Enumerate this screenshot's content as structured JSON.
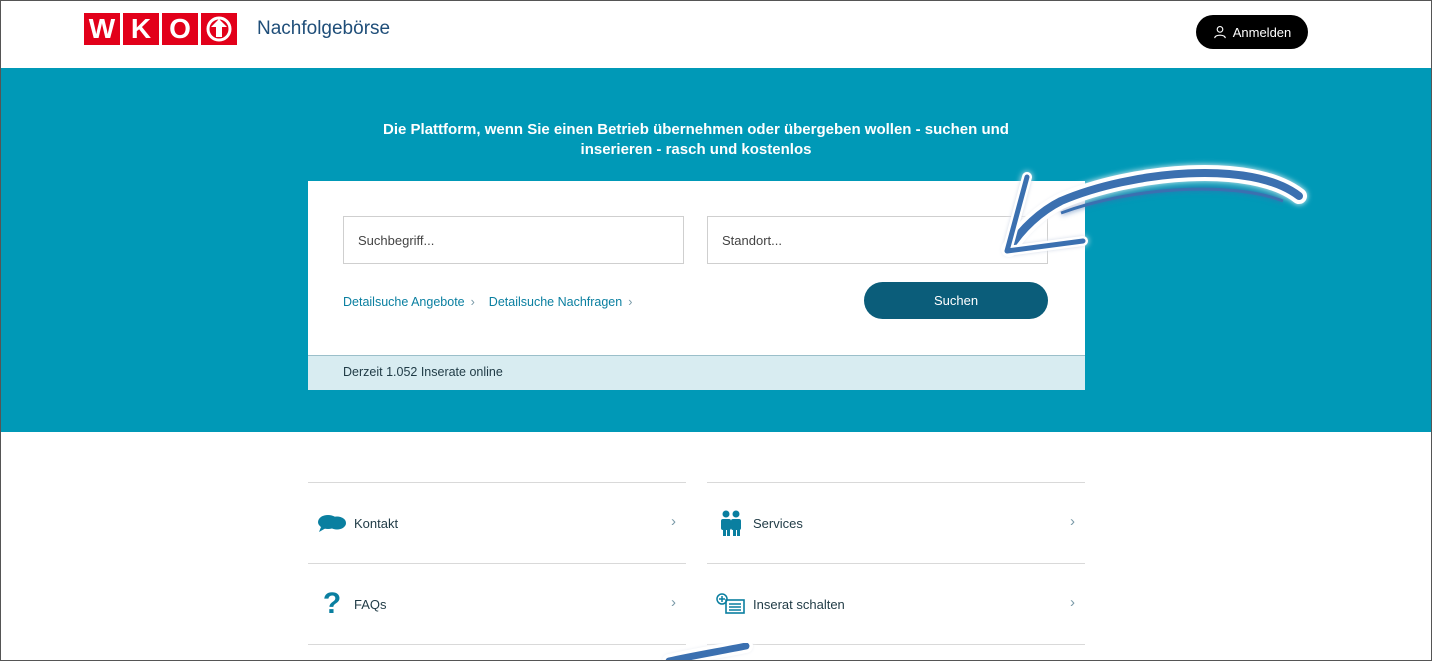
{
  "header": {
    "logo_letters": [
      "W",
      "K",
      "O"
    ],
    "brand": "Nachfolgebörse",
    "login_label": "Anmelden"
  },
  "hero": {
    "title_line1": "Die Plattform, wenn Sie einen Betrieb übernehmen oder übergeben wollen - suchen und",
    "title_line2": "inserieren - rasch und kostenlos",
    "search_placeholder": "Suchbegriff...",
    "location_placeholder": "Standort...",
    "link_offers": "Detailsuche Angebote",
    "link_requests": "Detailsuche Nachfragen",
    "search_button": "Suchen",
    "status": "Derzeit 1.052 Inserate online"
  },
  "tiles": [
    {
      "label": "Kontakt",
      "icon": "chat-bubbles-icon"
    },
    {
      "label": "Services",
      "icon": "people-icon"
    },
    {
      "label": "FAQs",
      "icon": "question-icon"
    },
    {
      "label": "Inserat schalten",
      "icon": "add-listing-icon"
    }
  ],
  "colors": {
    "accent": "#0099b7",
    "button": "#0b5d7a",
    "brand_red": "#e2001a",
    "status_bg": "#d8ecf1",
    "arrow": "#3b6fb0"
  }
}
